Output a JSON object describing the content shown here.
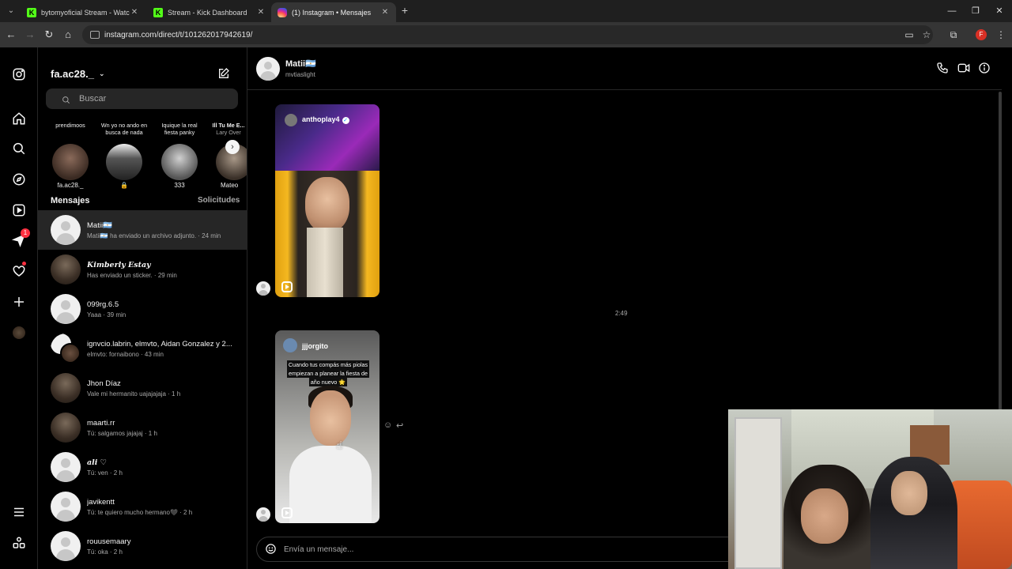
{
  "browser": {
    "tabs": [
      {
        "label": "bytomyoficial Stream - Watch L",
        "favicon": "kick"
      },
      {
        "label": "Stream - Kick Dashboard",
        "favicon": "kick"
      },
      {
        "label": "(1) Instagram • Mensajes",
        "favicon": "instagram",
        "active": true
      }
    ],
    "url": "instagram.com/direct/t/101262017942619/",
    "profile_initial": "F"
  },
  "leftnav": {
    "messages_badge": "1"
  },
  "inbox": {
    "account": "fa.ac28._",
    "search_placeholder": "Buscar",
    "notes": [
      {
        "text": "prendimoos",
        "name": "fa.ac28._"
      },
      {
        "text": "Wn yo no ando en busca de nada",
        "name": "🔒"
      },
      {
        "text": "Iquique la real fiesta panky",
        "name": "333"
      },
      {
        "text": "Ill Tu Me E...",
        "subtext": "Lary Over",
        "name": "Mateo"
      }
    ],
    "messages_heading": "Mensajes",
    "requests_label": "Solicitudes",
    "conversations": [
      {
        "name": "Matii🇦🇷",
        "preview": "Matii🇦🇷 ha enviado un archivo adjunto. · 24 min",
        "selected": true,
        "avatar": "default"
      },
      {
        "name": "Kimberly Estay",
        "preview": "Has enviado un sticker. · 29 min",
        "italic": true,
        "avatar": "photo"
      },
      {
        "name": "099rg.6.5",
        "preview": "Yaaa · 39 min",
        "avatar": "default"
      },
      {
        "name": "ignvcio.labrin, elmvto, Aidan Gonzalez y 2...",
        "preview": "elmvto: fornaibono · 43 min",
        "avatar": "group"
      },
      {
        "name": "Jhon Díaz",
        "preview": "Vale mi hermanito uajajajaja · 1 h",
        "avatar": "photo"
      },
      {
        "name": "maarti.rr",
        "preview": "Tú: salgamos jajajaj · 1 h",
        "avatar": "photo"
      },
      {
        "name": "ali ♡",
        "preview": "Tú: ven · 2 h",
        "italic": true,
        "avatar": "default"
      },
      {
        "name": "javikentt",
        "preview": "Tú: te quiero mucho hermano🖤 · 2 h",
        "avatar": "default"
      },
      {
        "name": "rouusemaary",
        "preview": "Tú: oka · 2 h",
        "avatar": "default"
      }
    ]
  },
  "thread": {
    "name": "Matii🇦🇷",
    "username": "mvtiaslight",
    "reel1": {
      "username": "anthoplay4",
      "verified": true
    },
    "timestamp": "2:49",
    "reel2": {
      "username": "jjjorgito",
      "caption": "Cuando tus compás más piolas empiezan a planear la fiesta de año nuevo 🌟"
    },
    "composer_placeholder": "Envía un mensaje..."
  }
}
